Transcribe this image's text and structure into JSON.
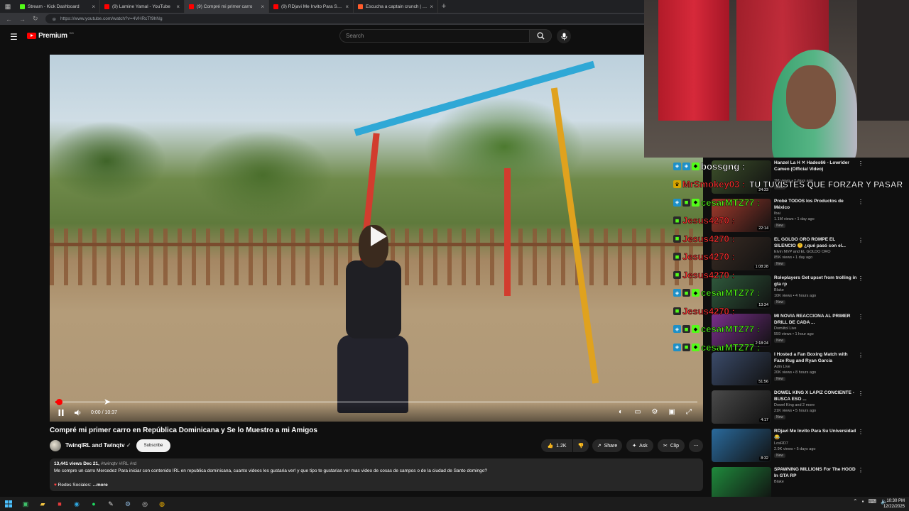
{
  "browser": {
    "tabs": [
      {
        "title": "Stream - Kick Dashboard",
        "color": "#53fc18",
        "active": false
      },
      {
        "title": "(9) Lamine Yamal - YouTube",
        "color": "#ff0000",
        "active": false
      },
      {
        "title": "(9) Compré mi primer carro",
        "color": "#ff0000",
        "active": true
      },
      {
        "title": "(9) RDjavi Me Invito Para Su Univ...",
        "color": "#ff0000",
        "active": false
      },
      {
        "title": "Escucha a captain crunch | Disfrut...",
        "color": "#ff5b2b",
        "active": false
      }
    ],
    "url": "https://www.youtube.com/watch?v=4VHRcTf9hNg"
  },
  "header": {
    "logo_text": "Premium",
    "logo_country": "DO",
    "search_placeholder": "Search"
  },
  "player": {
    "time": "0:00 / 10:37",
    "progress": 0.005
  },
  "video": {
    "title": "Compré mi primer carro en República Dominicana y Se lo Muestro a mi Amigos",
    "channel": "TwinqIRL and Twinqtv",
    "subscribe_label": "Subscribe",
    "likes": "1.2K",
    "share_label": "Share",
    "ask_label": "Ask",
    "clip_label": "Clip",
    "views_date": "13,441 views  Dec 21,",
    "tags": "#twinqtv #IRL #rd",
    "description": "Me compre un carro  Mercedez Para iniciar con contenido IRL en republica dominicana, cuanto videos les gustaria ver! y que tipo te gustarias ver mas video de cosas de campos o de la ciudad de Santo domingo?",
    "links_label": "Redes Sociales:",
    "more_label": "...more"
  },
  "recommendations": [
    {
      "title": "Hanzel La H ✕ Hades66 - Lowrider Cameo (Official Video)",
      "channel": "",
      "meta": "2M views • 2 days ago",
      "duration": "24:33",
      "thumb": "#3c4f2a"
    },
    {
      "title": "Probé TODOS los Productos de México",
      "channel": "Ibai",
      "meta": "1.1M views • 1 day ago",
      "duration": "22:14",
      "thumb": "#a23a2c"
    },
    {
      "title": "EL GOLDO ORO ROMPE EL SILENCIO 🤫 ¿qué pasó con el...",
      "channel": "Elvin MVP and EL GOLDO ORO",
      "meta": "85K views • 1 day ago",
      "duration": "1:08:28",
      "thumb": "#3a2c24"
    },
    {
      "title": "Roleplayers Get upset from trolling in gta rp",
      "channel": "Blake",
      "meta": "10K views • 4 hours ago",
      "duration": "13:34",
      "thumb": "#2f5a3c"
    },
    {
      "title": "MI NOVIA REACCIONA AL PRIMER DRILL DE CADA ...",
      "channel": "Domiitol Live",
      "meta": "559 views • 1 hour ago",
      "duration": "2:18:24",
      "thumb": "#7a2f8c"
    },
    {
      "title": "I Hosted a Fan Boxing Match with Faze Rug and Ryan Garcia",
      "channel": "Adin Live",
      "meta": "20K views • 8 hours ago",
      "duration": "51:56",
      "thumb": "#3b4b6a"
    },
    {
      "title": "DOWEL KING X LAPIZ CONCIENTE - BUSCA ESO ...",
      "channel": "Dowel King and 2 more",
      "meta": "21K views • 5 hours ago",
      "duration": "4:17",
      "thumb": "#4a4a4a"
    },
    {
      "title": "RDjavi Me Invito Para Su Universidad 😂",
      "channel": "LosRD7",
      "meta": "2.9K views • 5 days ago",
      "duration": "8:32",
      "thumb": "#2a6a9c"
    },
    {
      "title": "SPAWNING MILLIONS For The HOOD In GTA RP",
      "channel": "Blake",
      "meta": "",
      "duration": "",
      "thumb": "#1f8a3c"
    }
  ],
  "rec_badge": "New",
  "chat": [
    {
      "user": "bossgng :",
      "color": "#ffffff",
      "badges": [
        "blue",
        "blue",
        "green"
      ],
      "message": ""
    },
    {
      "user": "MrSmokey03 :",
      "color": "#ff3030",
      "badges": [
        "gold"
      ],
      "message": "TU TUVISTES QUE FORZAR Y PASAR"
    },
    {
      "user": "cesarMTZ77 :",
      "color": "#53fc18",
      "badges": [
        "blue",
        "dark",
        "green"
      ],
      "message": ""
    },
    {
      "user": "Jesus4270 :",
      "color": "#ff3030",
      "badges": [
        "dark"
      ],
      "message": ""
    },
    {
      "user": "Jesus4270 :",
      "color": "#ff3030",
      "badges": [
        "dark"
      ],
      "message": ""
    },
    {
      "user": "Jesus4270 :",
      "color": "#ff3030",
      "badges": [
        "dark"
      ],
      "message": ""
    },
    {
      "user": "Jesus4270 :",
      "color": "#ff3030",
      "badges": [
        "dark"
      ],
      "message": ""
    },
    {
      "user": "cesarMTZ77 :",
      "color": "#53fc18",
      "badges": [
        "blue",
        "dark",
        "green"
      ],
      "message": ""
    },
    {
      "user": "Jesus4270 :",
      "color": "#ff3030",
      "badges": [
        "dark"
      ],
      "message": ""
    },
    {
      "user": "cesarMTZ77 :",
      "color": "#53fc18",
      "badges": [
        "blue",
        "dark",
        "green"
      ],
      "message": ""
    },
    {
      "user": "cesarMTZ77 :",
      "color": "#53fc18",
      "badges": [
        "blue",
        "dark",
        "green"
      ],
      "message": ""
    }
  ],
  "taskbar": {
    "time": "10:30 PM",
    "date": "12/22/2025"
  }
}
